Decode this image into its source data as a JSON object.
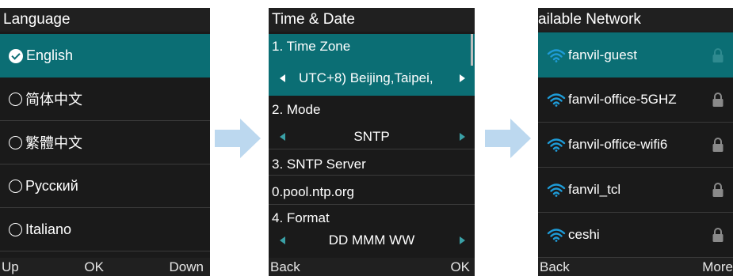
{
  "colors": {
    "selected_row": "#0b6e74",
    "screen_bg": "#1a1a1a",
    "wifi": "#1e9bd7",
    "arrow": "#bcd8ef"
  },
  "language_screen": {
    "title": "Language",
    "items": [
      {
        "label": "English",
        "selected": true
      },
      {
        "label": "简体中文",
        "selected": false
      },
      {
        "label": "繁體中文",
        "selected": false
      },
      {
        "label": "Русский",
        "selected": false
      },
      {
        "label": "Italiano",
        "selected": false
      }
    ],
    "softkeys": {
      "left": "Up",
      "center": "OK",
      "right": "Down"
    }
  },
  "time_screen": {
    "title": "Time & Date",
    "fields": [
      {
        "label": "1. Time Zone",
        "value": "UTC+8) Beijing,Taipei,"
      },
      {
        "label": "2. Mode",
        "value": "SNTP"
      },
      {
        "label": "3. SNTP Server",
        "value": "0.pool.ntp.org"
      },
      {
        "label": "4. Format",
        "value": "DD MMM WW"
      }
    ],
    "softkeys": {
      "left": "Back",
      "right": "OK"
    }
  },
  "network_screen": {
    "title": "ailable Network",
    "networks": [
      {
        "ssid": "fanvil-guest",
        "secured": true
      },
      {
        "ssid": "fanvil-office-5GHZ",
        "secured": true
      },
      {
        "ssid": "fanvil-office-wifi6",
        "secured": true
      },
      {
        "ssid": "fanvil_tcl",
        "secured": true
      },
      {
        "ssid": "ceshi",
        "secured": true
      }
    ],
    "softkeys": {
      "left": "Back",
      "right": "More"
    }
  }
}
